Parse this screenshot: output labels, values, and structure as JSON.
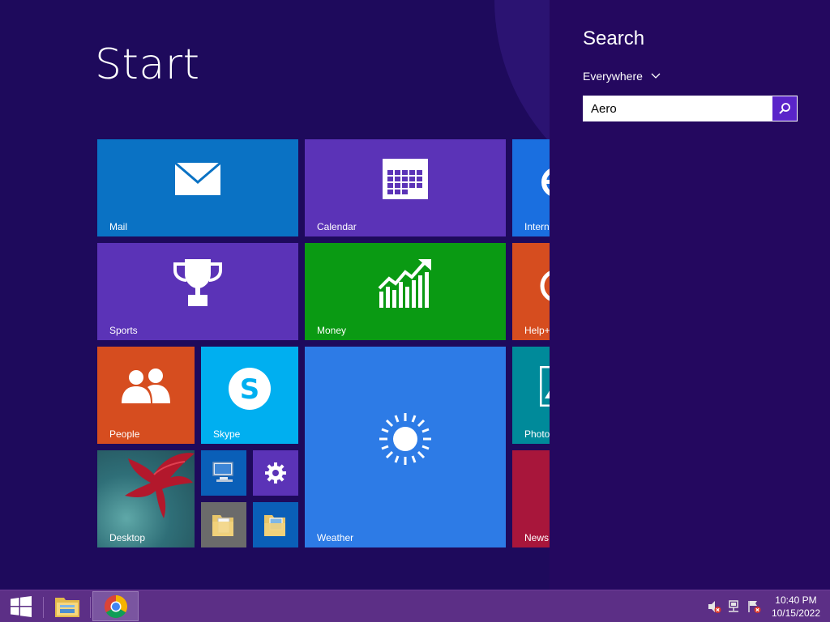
{
  "start": {
    "title": "Start",
    "tiles": {
      "mail": {
        "label": "Mail",
        "color": "#0a72c4"
      },
      "calendar": {
        "label": "Calendar",
        "color": "#5b33b7"
      },
      "internet_explorer": {
        "label": "Intern",
        "color": "#1a6fe0"
      },
      "sports": {
        "label": "Sports",
        "color": "#5b33b7"
      },
      "money": {
        "label": "Money",
        "color": "#0a9a13"
      },
      "help": {
        "label": "Help+",
        "color": "#d64d1f"
      },
      "people": {
        "label": "People",
        "color": "#d64d1f"
      },
      "skype": {
        "label": "Skype",
        "color": "#00aff0"
      },
      "weather": {
        "label": "Weather",
        "color": "#2d7be6"
      },
      "photos": {
        "label": "Photo",
        "color": "#008a9a"
      },
      "desktop": {
        "label": "Desktop"
      },
      "news": {
        "label": "News",
        "color": "#a8163b"
      }
    }
  },
  "search": {
    "title": "Search",
    "scope": "Everywhere",
    "query": "Aero"
  },
  "taskbar": {
    "apps": [
      "file-explorer",
      "chrome"
    ],
    "time": "10:40 PM",
    "date": "10/15/2022"
  }
}
